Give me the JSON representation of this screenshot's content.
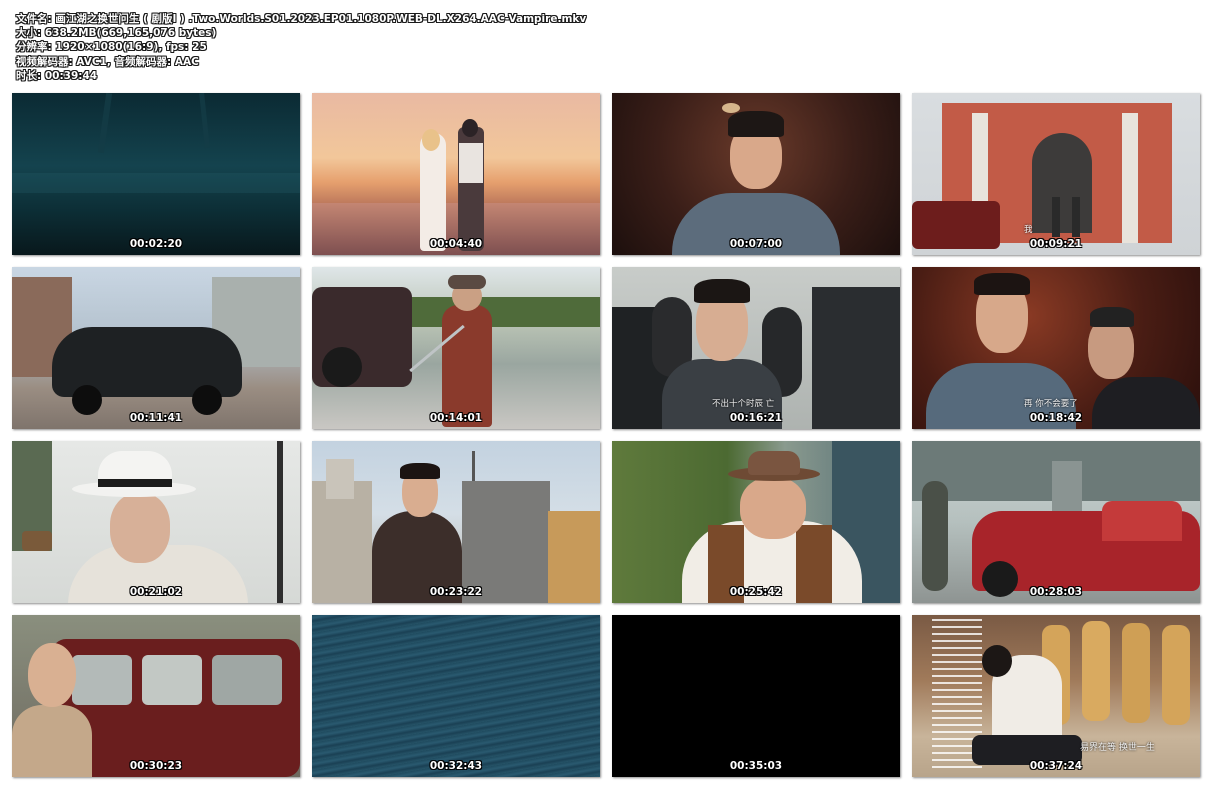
{
  "info": {
    "line1": "文件名: 画江湖之换世问生 ( 剧版I ) .Two.Worlds.S01.2023.EP01.1080P.WEB-DL.X264.AAC-Vampire.mkv",
    "line2": "大小: 638.2MB(669,165,076 bytes)",
    "line3": "分辨率: 1920×1080(16:9), fps: 25",
    "line4": "视频解码器: AVC1, 音频解码器: AAC",
    "line5": "时长: 00:39:44"
  },
  "thumbnails": [
    {
      "time": "00:02:20",
      "scene": "dark-water"
    },
    {
      "time": "00:04:40",
      "scene": "sunset-couple"
    },
    {
      "time": "00:07:00",
      "scene": "man-blue-robe"
    },
    {
      "time": "00:09:21",
      "scene": "building-facade",
      "subtitle": "我"
    },
    {
      "time": "00:11:41",
      "scene": "vintage-car-street"
    },
    {
      "time": "00:14:01",
      "scene": "man-sword-fight"
    },
    {
      "time": "00:16:21",
      "scene": "man-glasses-vest",
      "subtitle": "不出十个时辰 亡"
    },
    {
      "time": "00:18:42",
      "scene": "two-men-talking",
      "subtitle": "再 你不会要了"
    },
    {
      "time": "00:21:02",
      "scene": "man-white-hat"
    },
    {
      "time": "00:23:22",
      "scene": "man-leather-jacket"
    },
    {
      "time": "00:25:42",
      "scene": "man-cowboy-hat"
    },
    {
      "time": "00:28:03",
      "scene": "red-car-facade"
    },
    {
      "time": "00:30:23",
      "scene": "bald-man-van"
    },
    {
      "time": "00:32:43",
      "scene": "ocean-water"
    },
    {
      "time": "00:35:03",
      "scene": "black-frame"
    },
    {
      "time": "00:37:24",
      "scene": "credits-dance",
      "subtitle": "易界在等  换世一生"
    }
  ]
}
